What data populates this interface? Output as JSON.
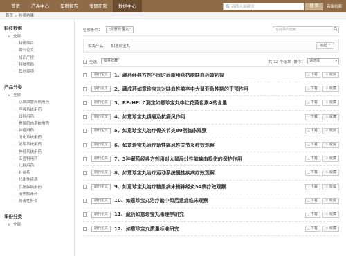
{
  "topnav": {
    "items": [
      "首页",
      "产品中心",
      "年度报告",
      "专题研究",
      "数据中心"
    ],
    "active_index": 4,
    "search_placeholder": "请输入关键词",
    "search_button": "搜 索",
    "advanced_link": "高级检索"
  },
  "breadcrumb": "首页 > 检索结果",
  "sidebar": {
    "sections": [
      {
        "title": "科技数据",
        "items": [
          "全部",
          "科研项目",
          "期刊论文",
          "知识产权",
          "科技奖励",
          "其他事项"
        ]
      },
      {
        "title": "产品分类",
        "items": [
          "全部",
          "心脑血管疾病用药",
          "呼吸系统用药",
          "妇科用药",
          "骨骼肌肉系统用药",
          "肿瘤用药",
          "消化系统用药",
          "泌尿系统用药",
          "神经系统用药",
          "五官科用药",
          "儿科用药",
          "补益药",
          "代谢性疾病",
          "肛肠疾病用药",
          "清热解毒药",
          "病毒性肝炎"
        ]
      },
      {
        "title": "年份分类",
        "items": [
          "全部"
        ]
      }
    ]
  },
  "conditions": {
    "label": "检索条件：",
    "tag": "\"如意珍宝丸\"",
    "within_placeholder": "在结果内检索"
  },
  "related": {
    "label": "相关产品：",
    "value": "如意珍宝丸",
    "collapse": "收起"
  },
  "toolbar": {
    "select_all": "全选",
    "batch": "批量收藏",
    "count_text": "共 12 个结果",
    "sort_label": "排序：",
    "sort_value": "请选择"
  },
  "results": [
    {
      "type": "期刊论文",
      "title": "1、藏药经典方剂不同时辰服用药抗脑缺血药效初探"
    },
    {
      "type": "期刊论文",
      "title": "2、藏成药如意珍宝丸对缺血性脑卒中大鼠亚急性期的干预作用"
    },
    {
      "type": "期刊论文",
      "title": "3、RP-HPLC测定如意珍宝丸中红花黄色素A的含量"
    },
    {
      "type": "期刊论文",
      "title": "4、如意珍宝丸镇痛及抗痛风作用"
    },
    {
      "type": "期刊论文",
      "title": "5、如意珍宝丸治疗骨关节炎80例临床观察"
    },
    {
      "type": "期刊论文",
      "title": "6、如意珍宝丸治疗急性痛风性关节炎疗效观察"
    },
    {
      "type": "期刊论文",
      "title": "7、3种藏药经典方剂用对大鼠局灶性脑缺血损伤的保护作用"
    },
    {
      "type": "期刊论文",
      "title": "8、如意珍宝丸治疗运动系统慢性疾病疗效观察"
    },
    {
      "type": "期刊论文",
      "title": "9、如意珍宝丸治疗糖尿病末梢神经炎54例疗效观察"
    },
    {
      "type": "期刊论文",
      "title": "10、如意珍宝丸治疗脑中风后遗症临床观察"
    },
    {
      "type": "期刊论文",
      "title": "11、藏药如意珍宝丸毒理学研究"
    },
    {
      "type": "期刊论文",
      "title": "12、如意珍宝丸质量标准研究"
    }
  ],
  "row_actions": {
    "download": "下载",
    "collect": "收藏"
  },
  "icons": {
    "search": "search-icon",
    "download": "download-icon",
    "star": "star-icon"
  }
}
